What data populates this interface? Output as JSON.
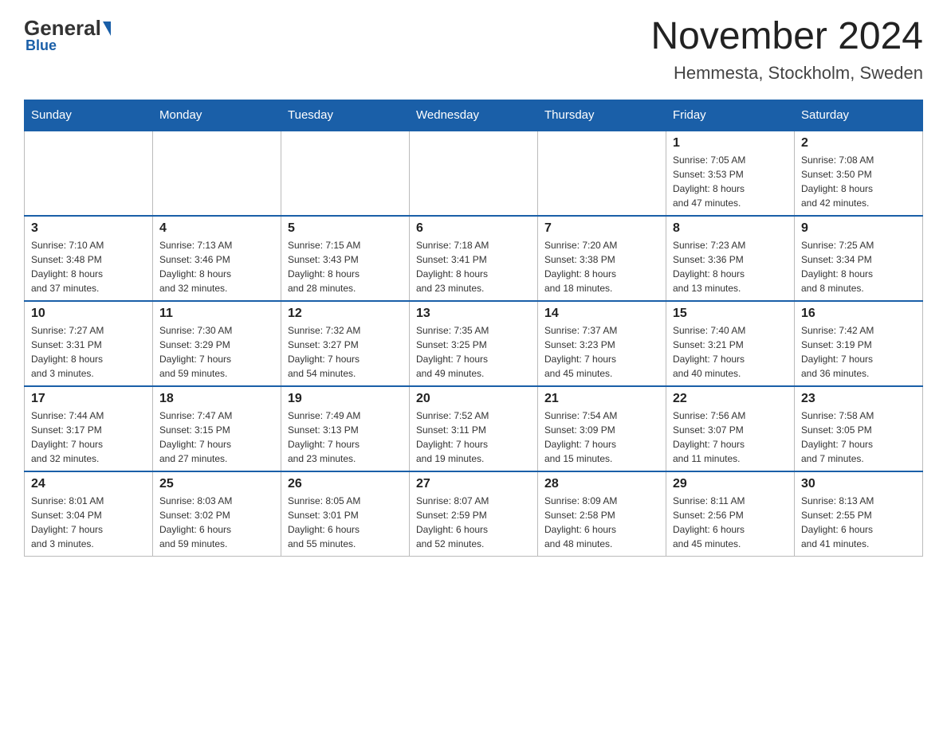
{
  "header": {
    "title": "November 2024",
    "subtitle": "Hemmesta, Stockholm, Sweden",
    "logo_general": "General",
    "logo_blue": "Blue"
  },
  "days_of_week": [
    "Sunday",
    "Monday",
    "Tuesday",
    "Wednesday",
    "Thursday",
    "Friday",
    "Saturday"
  ],
  "weeks": [
    {
      "days": [
        {
          "number": "",
          "info": ""
        },
        {
          "number": "",
          "info": ""
        },
        {
          "number": "",
          "info": ""
        },
        {
          "number": "",
          "info": ""
        },
        {
          "number": "",
          "info": ""
        },
        {
          "number": "1",
          "info": "Sunrise: 7:05 AM\nSunset: 3:53 PM\nDaylight: 8 hours\nand 47 minutes."
        },
        {
          "number": "2",
          "info": "Sunrise: 7:08 AM\nSunset: 3:50 PM\nDaylight: 8 hours\nand 42 minutes."
        }
      ]
    },
    {
      "days": [
        {
          "number": "3",
          "info": "Sunrise: 7:10 AM\nSunset: 3:48 PM\nDaylight: 8 hours\nand 37 minutes."
        },
        {
          "number": "4",
          "info": "Sunrise: 7:13 AM\nSunset: 3:46 PM\nDaylight: 8 hours\nand 32 minutes."
        },
        {
          "number": "5",
          "info": "Sunrise: 7:15 AM\nSunset: 3:43 PM\nDaylight: 8 hours\nand 28 minutes."
        },
        {
          "number": "6",
          "info": "Sunrise: 7:18 AM\nSunset: 3:41 PM\nDaylight: 8 hours\nand 23 minutes."
        },
        {
          "number": "7",
          "info": "Sunrise: 7:20 AM\nSunset: 3:38 PM\nDaylight: 8 hours\nand 18 minutes."
        },
        {
          "number": "8",
          "info": "Sunrise: 7:23 AM\nSunset: 3:36 PM\nDaylight: 8 hours\nand 13 minutes."
        },
        {
          "number": "9",
          "info": "Sunrise: 7:25 AM\nSunset: 3:34 PM\nDaylight: 8 hours\nand 8 minutes."
        }
      ]
    },
    {
      "days": [
        {
          "number": "10",
          "info": "Sunrise: 7:27 AM\nSunset: 3:31 PM\nDaylight: 8 hours\nand 3 minutes."
        },
        {
          "number": "11",
          "info": "Sunrise: 7:30 AM\nSunset: 3:29 PM\nDaylight: 7 hours\nand 59 minutes."
        },
        {
          "number": "12",
          "info": "Sunrise: 7:32 AM\nSunset: 3:27 PM\nDaylight: 7 hours\nand 54 minutes."
        },
        {
          "number": "13",
          "info": "Sunrise: 7:35 AM\nSunset: 3:25 PM\nDaylight: 7 hours\nand 49 minutes."
        },
        {
          "number": "14",
          "info": "Sunrise: 7:37 AM\nSunset: 3:23 PM\nDaylight: 7 hours\nand 45 minutes."
        },
        {
          "number": "15",
          "info": "Sunrise: 7:40 AM\nSunset: 3:21 PM\nDaylight: 7 hours\nand 40 minutes."
        },
        {
          "number": "16",
          "info": "Sunrise: 7:42 AM\nSunset: 3:19 PM\nDaylight: 7 hours\nand 36 minutes."
        }
      ]
    },
    {
      "days": [
        {
          "number": "17",
          "info": "Sunrise: 7:44 AM\nSunset: 3:17 PM\nDaylight: 7 hours\nand 32 minutes."
        },
        {
          "number": "18",
          "info": "Sunrise: 7:47 AM\nSunset: 3:15 PM\nDaylight: 7 hours\nand 27 minutes."
        },
        {
          "number": "19",
          "info": "Sunrise: 7:49 AM\nSunset: 3:13 PM\nDaylight: 7 hours\nand 23 minutes."
        },
        {
          "number": "20",
          "info": "Sunrise: 7:52 AM\nSunset: 3:11 PM\nDaylight: 7 hours\nand 19 minutes."
        },
        {
          "number": "21",
          "info": "Sunrise: 7:54 AM\nSunset: 3:09 PM\nDaylight: 7 hours\nand 15 minutes."
        },
        {
          "number": "22",
          "info": "Sunrise: 7:56 AM\nSunset: 3:07 PM\nDaylight: 7 hours\nand 11 minutes."
        },
        {
          "number": "23",
          "info": "Sunrise: 7:58 AM\nSunset: 3:05 PM\nDaylight: 7 hours\nand 7 minutes."
        }
      ]
    },
    {
      "days": [
        {
          "number": "24",
          "info": "Sunrise: 8:01 AM\nSunset: 3:04 PM\nDaylight: 7 hours\nand 3 minutes."
        },
        {
          "number": "25",
          "info": "Sunrise: 8:03 AM\nSunset: 3:02 PM\nDaylight: 6 hours\nand 59 minutes."
        },
        {
          "number": "26",
          "info": "Sunrise: 8:05 AM\nSunset: 3:01 PM\nDaylight: 6 hours\nand 55 minutes."
        },
        {
          "number": "27",
          "info": "Sunrise: 8:07 AM\nSunset: 2:59 PM\nDaylight: 6 hours\nand 52 minutes."
        },
        {
          "number": "28",
          "info": "Sunrise: 8:09 AM\nSunset: 2:58 PM\nDaylight: 6 hours\nand 48 minutes."
        },
        {
          "number": "29",
          "info": "Sunrise: 8:11 AM\nSunset: 2:56 PM\nDaylight: 6 hours\nand 45 minutes."
        },
        {
          "number": "30",
          "info": "Sunrise: 8:13 AM\nSunset: 2:55 PM\nDaylight: 6 hours\nand 41 minutes."
        }
      ]
    }
  ]
}
